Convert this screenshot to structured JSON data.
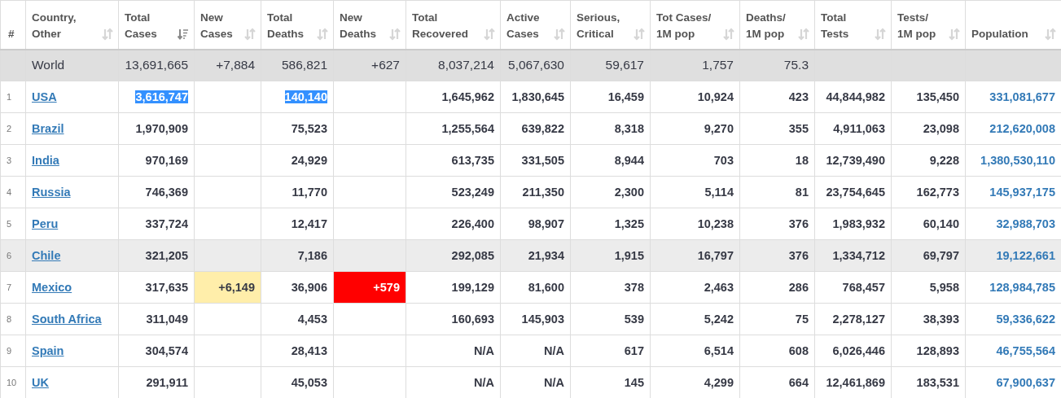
{
  "table": {
    "columns": [
      {
        "label_lines": [
          "#"
        ]
      },
      {
        "label_lines": [
          "Country,",
          "Other"
        ],
        "sorted": false
      },
      {
        "label_lines": [
          "Total",
          "Cases"
        ],
        "sorted": true
      },
      {
        "label_lines": [
          "New",
          "Cases"
        ],
        "sorted": false
      },
      {
        "label_lines": [
          "Total",
          "Deaths"
        ],
        "sorted": false
      },
      {
        "label_lines": [
          "New",
          "Deaths"
        ],
        "sorted": false
      },
      {
        "label_lines": [
          "Total",
          "Recovered"
        ],
        "sorted": false
      },
      {
        "label_lines": [
          "Active",
          "Cases"
        ],
        "sorted": false
      },
      {
        "label_lines": [
          "Serious,",
          "Critical"
        ],
        "sorted": false
      },
      {
        "label_lines": [
          "Tot Cases/",
          "1M pop"
        ],
        "sorted": false
      },
      {
        "label_lines": [
          "Deaths/",
          "1M pop"
        ],
        "sorted": false
      },
      {
        "label_lines": [
          "Total",
          "Tests"
        ],
        "sorted": false
      },
      {
        "label_lines": [
          "Tests/",
          "1M pop"
        ],
        "sorted": false
      },
      {
        "label_lines": [
          "Population"
        ],
        "sorted": false
      }
    ],
    "rows": [
      {
        "kind": "total",
        "cells": [
          null,
          "World",
          "13,691,665",
          "+7,884",
          "586,821",
          "+627",
          "8,037,214",
          "5,067,630",
          "59,617",
          "1,757",
          "75.3",
          null,
          null,
          null
        ]
      },
      {
        "kind": "country",
        "hovered": false,
        "cells": [
          {
            "text": "1",
            "selected": false
          },
          {
            "text": "USA",
            "selected": false
          },
          {
            "text": "3,616,747",
            "selected": true
          },
          null,
          {
            "text": "140,140",
            "selected": true
          },
          null,
          {
            "text": "1,645,962",
            "selected": false
          },
          {
            "text": "1,830,645",
            "selected": false
          },
          {
            "text": "16,459",
            "selected": false
          },
          {
            "text": "10,924",
            "selected": false
          },
          {
            "text": "423",
            "selected": false
          },
          {
            "text": "44,844,982",
            "selected": false
          },
          {
            "text": "135,450",
            "selected": false
          },
          {
            "text": "331,081,677",
            "selected": false
          }
        ]
      },
      {
        "kind": "country",
        "cells": [
          "2",
          "Brazil",
          "1,970,909",
          null,
          "75,523",
          null,
          "1,255,564",
          "639,822",
          "8,318",
          "9,270",
          "355",
          "4,911,063",
          "23,098",
          "212,620,008"
        ]
      },
      {
        "kind": "country",
        "cells": [
          "3",
          "India",
          "970,169",
          null,
          "24,929",
          null,
          "613,735",
          "331,505",
          "8,944",
          "703",
          "18",
          "12,739,490",
          "9,228",
          "1,380,530,110"
        ]
      },
      {
        "kind": "country",
        "cells": [
          "4",
          "Russia",
          "746,369",
          null,
          "11,770",
          null,
          "523,249",
          "211,350",
          "2,300",
          "5,114",
          "81",
          "23,754,645",
          "162,773",
          "145,937,175"
        ]
      },
      {
        "kind": "country",
        "cells": [
          "5",
          "Peru",
          "337,724",
          null,
          "12,417",
          null,
          "226,400",
          "98,907",
          "1,325",
          "10,238",
          "376",
          "1,983,932",
          "60,140",
          "32,988,703"
        ]
      },
      {
        "kind": "country",
        "hovered": true,
        "cells": [
          "6",
          "Chile",
          "321,205",
          null,
          "7,186",
          null,
          "292,085",
          "21,934",
          "1,915",
          "16,797",
          "376",
          "1,334,712",
          "69,797",
          "19,122,661"
        ]
      },
      {
        "kind": "country",
        "cells": [
          "7",
          "Mexico",
          "317,635",
          "+6,149",
          "36,906",
          "+579",
          "199,129",
          "81,600",
          "378",
          "2,463",
          "286",
          "768,457",
          "5,958",
          "128,984,785"
        ]
      },
      {
        "kind": "country",
        "cells": [
          "8",
          "South Africa",
          "311,049",
          null,
          "4,453",
          null,
          "160,693",
          "145,903",
          "539",
          "5,242",
          "75",
          "2,278,127",
          "38,393",
          "59,336,622"
        ]
      },
      {
        "kind": "country",
        "cells": [
          "9",
          "Spain",
          "304,574",
          null,
          "28,413",
          null,
          "N/A",
          "N/A",
          "617",
          "6,514",
          "608",
          "6,026,446",
          "128,893",
          "46,755,564"
        ]
      },
      {
        "kind": "country",
        "cells": [
          "10",
          "UK",
          "291,911",
          null,
          "45,053",
          null,
          "N/A",
          "N/A",
          "145",
          "4,299",
          "664",
          "12,461,869",
          "183,531",
          "67,900,637"
        ]
      }
    ]
  }
}
